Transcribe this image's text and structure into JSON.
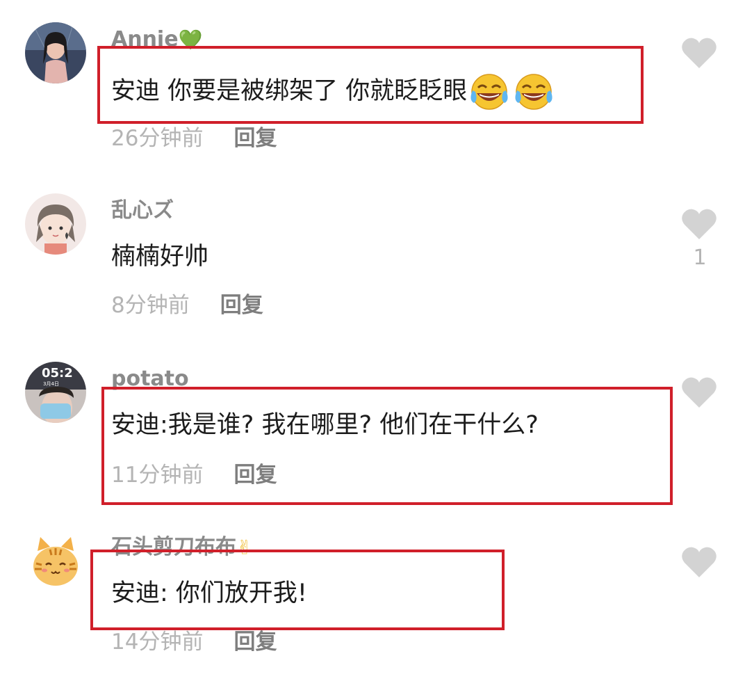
{
  "comments": [
    {
      "username": "Annie",
      "username_emoji": "💚",
      "content": "安迪 你要是被绑架了 你就眨眨眼",
      "content_emoji": "🤣🤣",
      "time": "26分钟前",
      "reply": "回复",
      "likes": ""
    },
    {
      "username": "乱心ズ",
      "username_emoji": "",
      "content": "楠楠好帅",
      "content_emoji": "",
      "time": "8分钟前",
      "reply": "回复",
      "likes": "1"
    },
    {
      "username": "potato",
      "username_emoji": "",
      "content": "安迪:我是谁? 我在哪里? 他们在干什么?",
      "content_emoji": "",
      "time": "11分钟前",
      "reply": "回复",
      "likes": ""
    },
    {
      "username": "石头剪刀布布",
      "username_emoji": "✌",
      "content": "安迪: 你们放开我!",
      "content_emoji": "",
      "time": "14分钟前",
      "reply": "回复",
      "likes": ""
    }
  ],
  "avatar_3_clock": {
    "time": "05:2",
    "date": "3月4日"
  },
  "colors": {
    "highlight_border": "#d01f2a",
    "username": "#8a8a8a",
    "content": "#1c1c1c",
    "timestamp": "#b4b4b4",
    "reply": "#7e7e7e",
    "like_heart": "#d3d3d3"
  },
  "icons": {
    "like": "heart-icon"
  }
}
